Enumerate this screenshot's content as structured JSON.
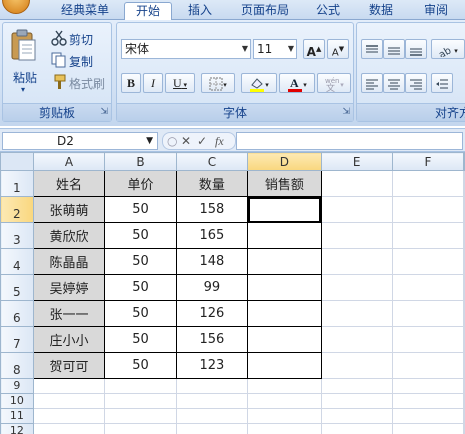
{
  "tabs": [
    "经典菜单",
    "开始",
    "插入",
    "页面布局",
    "公式",
    "数据",
    "审阅"
  ],
  "clipboard": {
    "paste": "粘贴",
    "cut": "剪切",
    "copy": "复制",
    "format_painter": "格式刷",
    "title": "剪贴板"
  },
  "font": {
    "name": "宋体",
    "size": "11",
    "bold": "B",
    "italic": "I",
    "underline": "U",
    "grow": "A",
    "shrink": "A",
    "title": "字体"
  },
  "align": {
    "title": "对齐方"
  },
  "formula_bar": {
    "cell_ref": "D2",
    "fx": "fx",
    "formula": ""
  },
  "grid": {
    "columns": [
      "A",
      "B",
      "C",
      "D",
      "E",
      "F"
    ],
    "rows": [
      {
        "num": "1",
        "cells": [
          "姓名",
          "单价",
          "数量",
          "销售额"
        ]
      },
      {
        "num": "2",
        "cells": [
          "张萌萌",
          "50",
          "158",
          ""
        ]
      },
      {
        "num": "3",
        "cells": [
          "黄欣欣",
          "50",
          "165",
          ""
        ]
      },
      {
        "num": "4",
        "cells": [
          "陈晶晶",
          "50",
          "148",
          ""
        ]
      },
      {
        "num": "5",
        "cells": [
          "吴婷婷",
          "50",
          "99",
          ""
        ]
      },
      {
        "num": "6",
        "cells": [
          "张一一",
          "50",
          "126",
          ""
        ]
      },
      {
        "num": "7",
        "cells": [
          "庄小小",
          "50",
          "156",
          ""
        ]
      },
      {
        "num": "8",
        "cells": [
          "贺可可",
          "50",
          "123",
          ""
        ]
      },
      {
        "num": "9",
        "cells": [
          "",
          "",
          "",
          ""
        ]
      },
      {
        "num": "10",
        "cells": [
          "",
          "",
          "",
          ""
        ]
      },
      {
        "num": "11",
        "cells": [
          "",
          "",
          "",
          ""
        ]
      },
      {
        "num": "12",
        "cells": [
          "",
          "",
          "",
          ""
        ]
      }
    ]
  }
}
